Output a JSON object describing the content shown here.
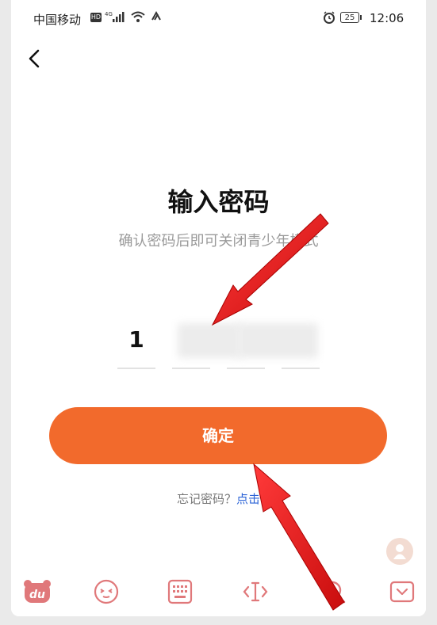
{
  "status_bar": {
    "carrier": "中国移动",
    "hd_badge": "HD",
    "battery": "25",
    "time": "12:06"
  },
  "header": {
    "back_icon": "chevron-left-icon"
  },
  "main": {
    "title": "输入密码",
    "subtitle": "确认密码后即可关闭青少年模式",
    "pin_digits": [
      "1",
      "",
      "",
      ""
    ],
    "confirm_label": "确定",
    "forgot_prefix": "忘记密码？",
    "forgot_link": "点击"
  },
  "keyboard_toolbar": {
    "items": [
      "du-logo-icon",
      "emoji-icon",
      "keyboard-icon",
      "cursor-icon",
      "search-icon",
      "collapse-keyboard-icon"
    ]
  },
  "colors": {
    "accent": "#f26a2c",
    "link": "#2a62d6",
    "keyboard_icon": "#e0787a",
    "annotation_arrow": "#e51a1a"
  }
}
